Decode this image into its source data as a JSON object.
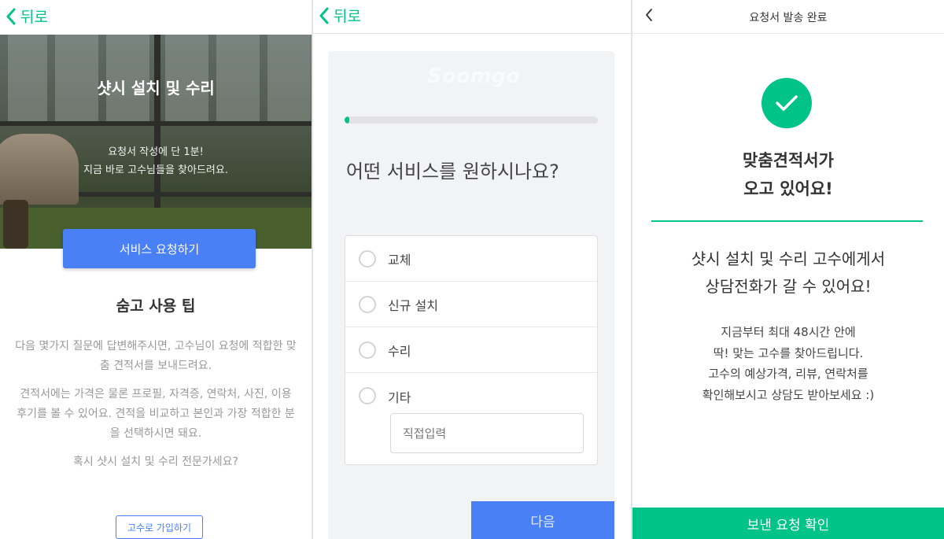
{
  "colors": {
    "accent_green": "#00c389",
    "accent_blue": "#4a80f5"
  },
  "panel1": {
    "back_label": "뒤로",
    "hero_title": "샷시 설치 및 수리",
    "hero_sub_1": "요청서 작성에 단 1분!",
    "hero_sub_2": "지금 바로 고수님들을 찾아드려요.",
    "cta_label": "서비스 요청하기",
    "tips_title": "숨고 사용 팁",
    "tip_1": "다음 몇가지 질문에 답변해주시면, 고수님이 요청에 적합한 맞춤 견적서를 보내드려요.",
    "tip_2": "견적서에는 가격은 물론 프로필, 자격증, 연락처, 사진, 이용 후기를 볼 수 있어요. 견적을 비교하고 본인과 가장 적합한 분을 선택하시면 돼요.",
    "tip_3": "혹시 샷시 설치 및 수리 전문가세요?",
    "signup_label": "고수로 가입하기"
  },
  "panel2": {
    "back_label": "뒤로",
    "logo": "Soomgo",
    "progress": 0.02,
    "question": "어떤 서비스를 원하시나요?",
    "options": [
      "교체",
      "신규 설치",
      "수리",
      "기타"
    ],
    "direct_placeholder": "직접입력",
    "next_label": "다음"
  },
  "panel3": {
    "title": "요청서 발송 완료",
    "headline_1": "맞춤견적서가",
    "headline_2": "오고 있어요!",
    "mid_1": "샷시 설치 및 수리 고수에게서",
    "mid_2": "상담전화가 갈 수 있어요!",
    "info_1": "지금부터 최대 48시간 안에",
    "info_2": "딱! 맞는 고수를 찾아드립니다.",
    "info_3": "고수의 예상가격, 리뷰, 연락처를",
    "info_4": "확인해보시고 상담도 받아보세요 :)",
    "confirm_label": "보낸 요청 확인"
  }
}
